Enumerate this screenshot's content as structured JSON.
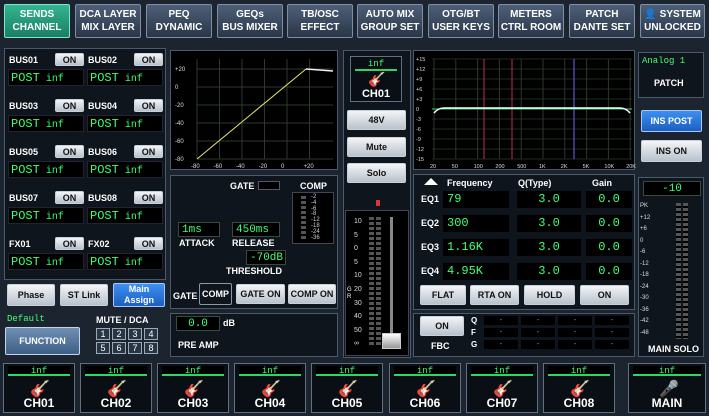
{
  "tabs": [
    {
      "l1": "SENDS",
      "l2": "CHANNEL",
      "active": true
    },
    {
      "l1": "DCA LAYER",
      "l2": "MIX LAYER"
    },
    {
      "l1": "PEQ",
      "l2": "DYNAMIC"
    },
    {
      "l1": "GEQs",
      "l2": "BUS MIXER"
    },
    {
      "l1": "TB/OSC",
      "l2": "EFFECT"
    },
    {
      "l1": "AUTO MIX",
      "l2": "GROUP SET"
    },
    {
      "l1": "OTG/BT",
      "l2": "USER KEYS"
    },
    {
      "l1": "METERS",
      "l2": "CTRL ROOM"
    },
    {
      "l1": "PATCH",
      "l2": "DANTE SET"
    },
    {
      "l1": "SYSTEM",
      "l2": "UNLOCKED"
    }
  ],
  "buses": [
    {
      "name": "BUS01",
      "on": "ON",
      "post": "POST",
      "val": "inf"
    },
    {
      "name": "BUS02",
      "on": "ON",
      "post": "POST",
      "val": "inf"
    },
    {
      "name": "BUS03",
      "on": "ON",
      "post": "POST",
      "val": "inf"
    },
    {
      "name": "BUS04",
      "on": "ON",
      "post": "POST",
      "val": "inf"
    },
    {
      "name": "BUS05",
      "on": "ON",
      "post": "POST",
      "val": "inf"
    },
    {
      "name": "BUS06",
      "on": "ON",
      "post": "POST",
      "val": "inf"
    },
    {
      "name": "BUS07",
      "on": "ON",
      "post": "POST",
      "val": "inf"
    },
    {
      "name": "BUS08",
      "on": "ON",
      "post": "POST",
      "val": "inf"
    },
    {
      "name": "FX01",
      "on": "ON",
      "post": "POST",
      "val": "inf"
    },
    {
      "name": "FX02",
      "on": "ON",
      "post": "POST",
      "val": "inf"
    }
  ],
  "left_buttons": {
    "phase": "Phase",
    "st_link": "ST Link",
    "main_assign_1": "Main",
    "main_assign_2": "Assign"
  },
  "function": {
    "default": "Default",
    "label": "FUNCTION"
  },
  "mute_dca": {
    "title": "MUTE / DCA",
    "nums": [
      "1",
      "2",
      "3",
      "4",
      "5",
      "6",
      "7",
      "8"
    ]
  },
  "dyn_graph": {
    "xticks": [
      "-80",
      "-60",
      "-40",
      "-20",
      "0",
      "+20"
    ],
    "yticks": [
      "+20",
      "0",
      "-20",
      "-40",
      "-60",
      "-80"
    ]
  },
  "dynamics": {
    "gate": "GATE",
    "comp": "COMP",
    "comp_scale": [
      "-2",
      "-4",
      "-6",
      "-8",
      "-12",
      "-18",
      "-24",
      "-36"
    ],
    "attack_val": "1ms",
    "attack": "ATTACK",
    "release_val": "450ms",
    "release": "RELEASE",
    "threshold_val": "-70dB",
    "threshold": "THRESHOLD",
    "gate_btn": "GATE",
    "comp_btn": "COMP",
    "gate_on": "GATE ON",
    "comp_on": "COMP ON"
  },
  "preamp": {
    "val": "0.0",
    "unit": "dB",
    "label": "PRE AMP"
  },
  "channel": {
    "val": "inf",
    "name": "CH01",
    "v48": "48V",
    "mute": "Mute",
    "solo": "Solo",
    "fader_scale": [
      "10",
      "5",
      "0",
      "5",
      "10",
      "20",
      "30",
      "40",
      "50",
      "∞"
    ],
    "gr": "G R"
  },
  "peq_graph": {
    "yticks": [
      "+15",
      "+12",
      "+9",
      "+6",
      "+3",
      "0",
      "-3",
      "-6",
      "-9",
      "-12",
      "-15"
    ],
    "xticks": [
      "20",
      "50",
      "100",
      "200",
      "500",
      "1K",
      "2K",
      "5K",
      "10K",
      "20K"
    ]
  },
  "eq": {
    "headers": [
      "Frequency",
      "Q(Type)",
      "Gain"
    ],
    "rows": [
      {
        "k": "EQ1",
        "f": "79",
        "q": "3.0",
        "g": "0.0"
      },
      {
        "k": "EQ2",
        "f": "300",
        "q": "3.0",
        "g": "0.0"
      },
      {
        "k": "EQ3",
        "f": "1.16K",
        "q": "3.0",
        "g": "0.0"
      },
      {
        "k": "EQ4",
        "f": "4.95K",
        "q": "3.0",
        "g": "0.0"
      }
    ],
    "flat": "FLAT",
    "rta_on": "RTA ON",
    "hold": "HOLD",
    "on": "ON"
  },
  "fbc": {
    "on": "ON",
    "label": "FBC",
    "rows": [
      "Q",
      "F",
      "G"
    ],
    "dash": "-"
  },
  "right": {
    "analog": "Analog 1",
    "patch": "PATCH",
    "ins_post": "INS POST",
    "ins_on": "INS ON",
    "level": "-10",
    "main_solo": "MAIN SOLO",
    "scale": [
      "PK",
      "+12",
      "+6",
      "0",
      "-6",
      "-12",
      "-18",
      "-24",
      "-30",
      "-36",
      "-42",
      "-48"
    ]
  },
  "channels": [
    {
      "val": "inf",
      "name": "CH01"
    },
    {
      "val": "inf",
      "name": "CH02"
    },
    {
      "val": "inf",
      "name": "CH03"
    },
    {
      "val": "inf",
      "name": "CH04"
    },
    {
      "val": "inf",
      "name": "CH05"
    },
    {
      "val": "inf",
      "name": "CH06"
    },
    {
      "val": "inf",
      "name": "CH07"
    },
    {
      "val": "inf",
      "name": "CH08"
    },
    {
      "val": "inf",
      "name": "MAIN"
    }
  ]
}
